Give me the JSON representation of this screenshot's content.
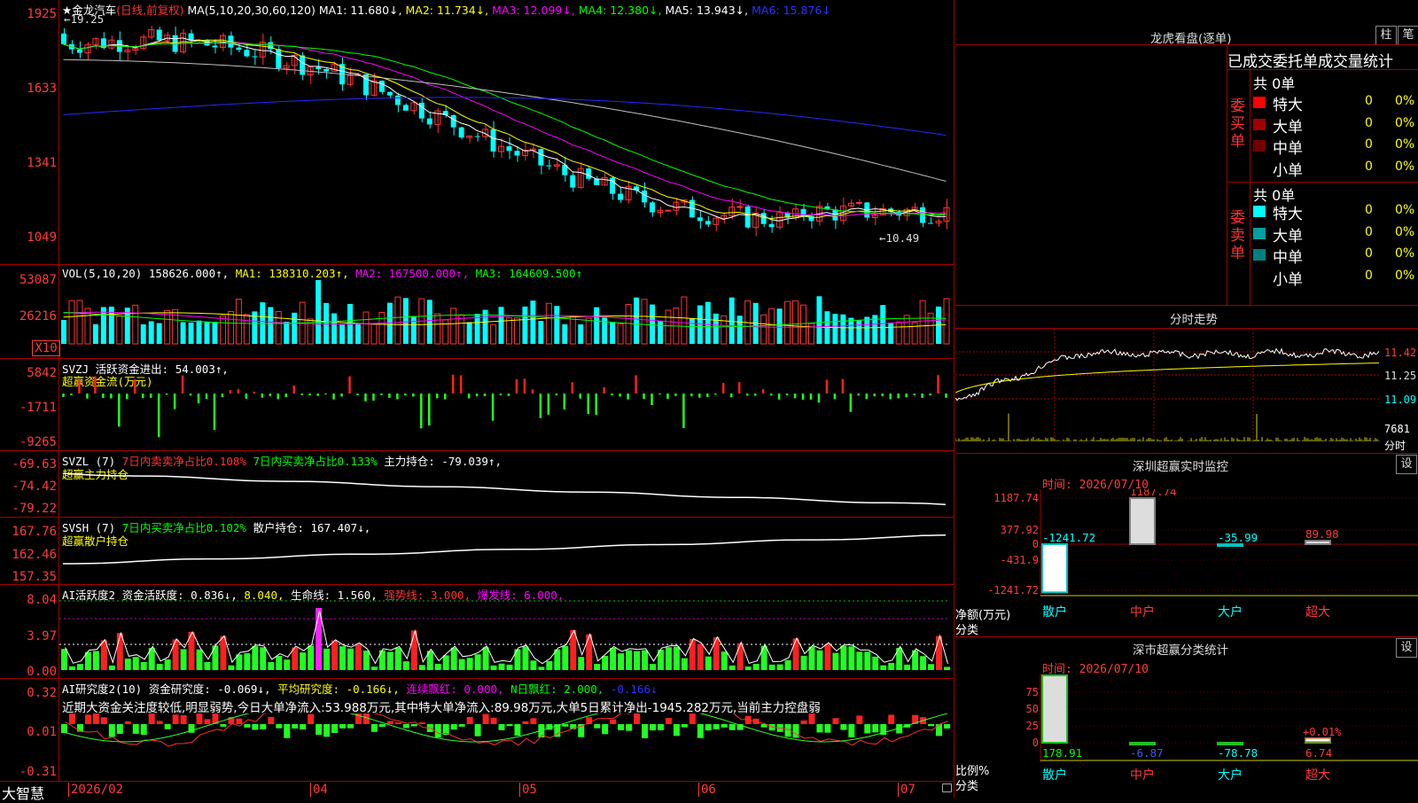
{
  "stock": {
    "name": "金龙汽车",
    "period_label": "(日线,前复权)",
    "ma_header": "MA(5,10,20,30,60,120)",
    "ma1": "MA1: 11.680↓,",
    "ma2": "MA2: 11.734↓,",
    "ma3": "MA3: 12.099↓,",
    "ma4": "MA4: 12.380↓,",
    "ma5": "MA5: 13.943↓,",
    "ma6": "MA6: 15.876↓",
    "high_marker": "←19.25",
    "low_marker": "←10.49"
  },
  "price_axis": [
    "1925",
    "1633",
    "1341",
    "1049"
  ],
  "vol": {
    "header": "VOL(5,10,20)",
    "value": "158626.000↑,",
    "ma1": "MA1: 138310.203↑,",
    "ma2": "MA2: 167500.000↑,",
    "ma3": "MA3: 164609.500↑",
    "axis": [
      "53087",
      "26216",
      "X10"
    ]
  },
  "svzj": {
    "header": "SVZJ",
    "line1": "活跃资金进出: 54.003↑,",
    "line2": "超赢资金流(万元)",
    "axis": [
      "5842",
      "-1711",
      "-9265"
    ]
  },
  "svzl": {
    "header": "SVZL (7)",
    "t1": "7日内卖卖净占比0.108%",
    "t2": "7日内买卖净占比0.133%",
    "t3": "主力持仓: -79.039↑,",
    "line2": "超赢主力持仓",
    "axis": [
      "-69.63",
      "-74.42",
      "-79.22"
    ]
  },
  "svsh": {
    "header": "SVSH (7)",
    "t1": "7日内买卖净占比0.102%",
    "t2": "散户持仓: 167.407↓,",
    "line2": "超赢散户持仓",
    "axis": [
      "167.76",
      "162.46",
      "157.35"
    ]
  },
  "ai1": {
    "header": "AI活跃度2",
    "t1": "资金活跃度: 0.836↓,",
    "t2": "8.040,",
    "t3": "生命线: 1.560,",
    "t4": "强势线: 3.000,",
    "t5": "爆发线: 6.000,",
    "axis": [
      "8.04",
      "3.97",
      "0.00"
    ]
  },
  "ai2": {
    "header": "AI研究度2(10)",
    "t1": "资金研究度: -0.069↓,",
    "t2": "平均研究度: -0.166↓,",
    "t3": "连续飘红: 0.000,",
    "t4": "N日飘红: 2.000,",
    "t5": "-0.166↓",
    "comment": "近期大资金关注度较低,明显弱势,今日大单净流入:53.988万元,其中特大单净流入:89.98万元,大单5日累计净出-1945.282万元,当前主力控盘弱",
    "axis": [
      "0.32",
      "0.01",
      "-0.31"
    ]
  },
  "xaxis": {
    "brand": "大智慧",
    "labels": [
      "2026/02",
      "04",
      "05",
      "06",
      "07"
    ]
  },
  "dragon": {
    "title": "龙虎看盘(逐单)",
    "btn_zhu": "柱",
    "btn_bi": "笔",
    "subtitle": "已成交委托单成交量统计",
    "buy_label": "委买单",
    "sell_label": "委卖单",
    "buy_total": "共 0单",
    "sell_total": "共 0单",
    "buy_rows": [
      {
        "label": "特大",
        "count": "0",
        "pct": "0%",
        "color": "#ff0000"
      },
      {
        "label": "大单",
        "count": "0",
        "pct": "0%",
        "color": "#a00000"
      },
      {
        "label": "中单",
        "count": "0",
        "pct": "0%",
        "color": "#700000"
      },
      {
        "label": "小单",
        "count": "0",
        "pct": "0%",
        "color": "#000000"
      }
    ],
    "sell_rows": [
      {
        "label": "特大",
        "count": "0",
        "pct": "0%",
        "color": "#00ffff"
      },
      {
        "label": "大单",
        "count": "0",
        "pct": "0%",
        "color": "#00a0a0"
      },
      {
        "label": "中单",
        "count": "0",
        "pct": "0%",
        "color": "#008080"
      },
      {
        "label": "小单",
        "count": "0",
        "pct": "0%",
        "color": "#000000"
      }
    ]
  },
  "intraday": {
    "title": "分时走势",
    "price_ticks": [
      "11.42",
      "11.25",
      "11.09"
    ],
    "vol_tick": "7681",
    "vol_unit": "分时"
  },
  "monitor": {
    "title": "深圳超赢实时监控",
    "setting": "设",
    "time_label": "时间: 2026/07/10",
    "axis": [
      "1187.74",
      "377.92",
      "0",
      "-431.9",
      "-1241.72"
    ],
    "y_unit": "净额(万元)",
    "x_unit": "分类",
    "chart_data": {
      "type": "bar",
      "categories": [
        "散户",
        "中户",
        "大户",
        "超大"
      ],
      "values": [
        -1241.72,
        1187.74,
        -35.99,
        89.98
      ],
      "value_labels": [
        "-1241.72",
        "1187.74",
        "-35.99",
        "89.98"
      ],
      "ylim": [
        -1241.72,
        1187.74
      ]
    }
  },
  "classify": {
    "title": "深市超赢分类统计",
    "setting": "设",
    "time_label": "时间: 2026/07/10",
    "axis": [
      "75",
      "50",
      "25",
      "0"
    ],
    "y_unit": "比例%",
    "x_unit": "分类",
    "chart_data": {
      "type": "bar",
      "categories": [
        "散户",
        "中户",
        "大户",
        "超大"
      ],
      "values": [
        178.91,
        -6.87,
        -78.78,
        6.74
      ],
      "value_labels": [
        "178.91",
        "-6.87",
        "-78.78",
        "6.74"
      ],
      "extra_label": "+0.01%",
      "ylim": [
        0,
        75
      ]
    }
  }
}
